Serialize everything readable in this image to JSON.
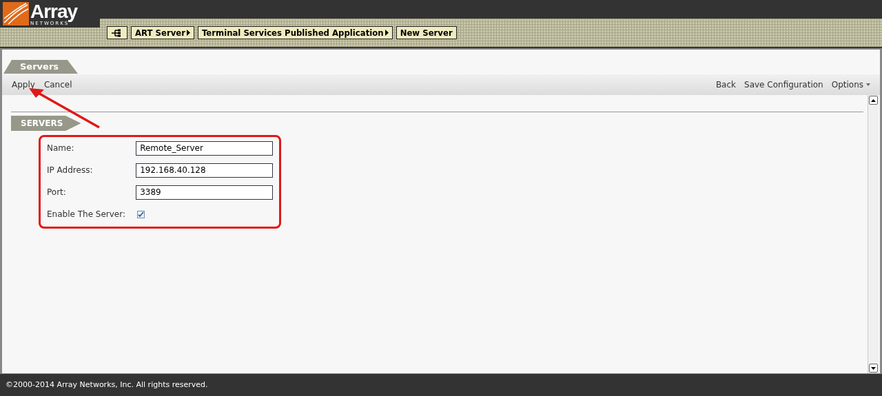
{
  "logo": {
    "name": "Array",
    "tagline": "NETWORKS"
  },
  "breadcrumb": [
    {
      "label": "ART Server",
      "arrow": true
    },
    {
      "label": "Terminal Services Published Application",
      "arrow": true
    },
    {
      "label": "New Server",
      "arrow": false
    }
  ],
  "page_tab": "Servers",
  "toolbar": {
    "left": [
      "Apply",
      "Cancel"
    ],
    "right": [
      {
        "label": "Back",
        "menu": false
      },
      {
        "label": "Save Configuration",
        "menu": false
      },
      {
        "label": "Options",
        "menu": true
      }
    ]
  },
  "section": "SERVERS",
  "fields": [
    {
      "kind": "text",
      "label": "Name:",
      "value": "Remote_Server"
    },
    {
      "kind": "text",
      "label": "IP Address:",
      "value": "192.168.40.128"
    },
    {
      "kind": "text",
      "label": "Port:",
      "value": "3389"
    },
    {
      "kind": "checkbox",
      "label": "Enable The Server:",
      "checked": true
    }
  ],
  "footer": "©2000-2014 Array Networks, Inc. All rights reserved."
}
